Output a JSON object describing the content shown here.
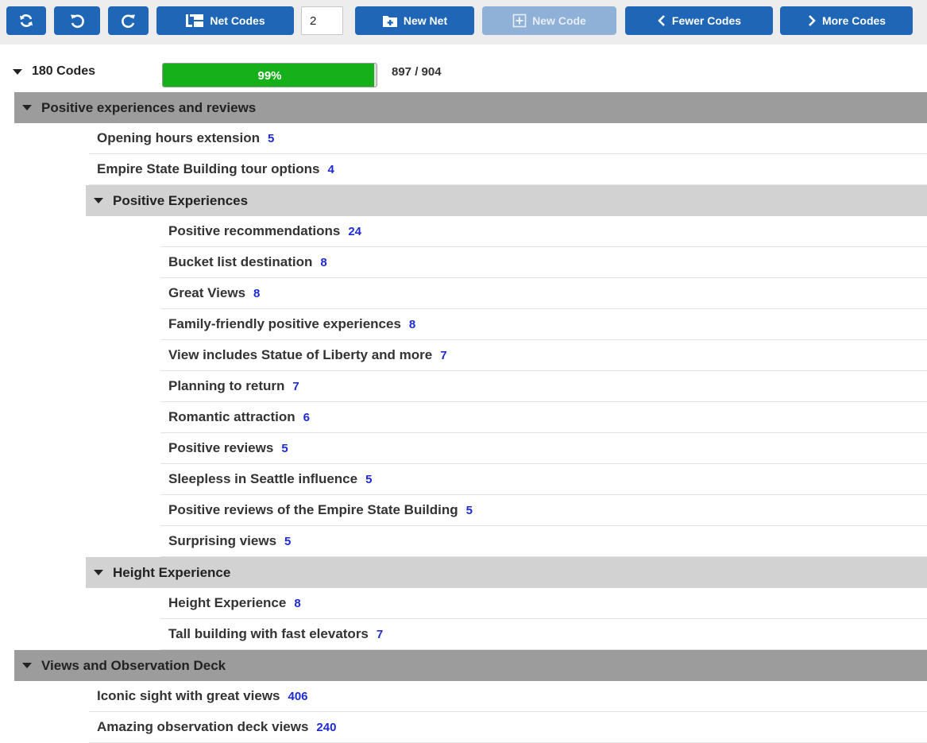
{
  "toolbar": {
    "net_codes_label": "Net Codes",
    "level_value": "2",
    "new_net_label": "New Net",
    "new_code_label": "New Code",
    "fewer_codes_label": "Fewer Codes",
    "more_codes_label": "More Codes"
  },
  "summary": {
    "codes_label": "180 Codes",
    "progress_text": "99%",
    "progress_value": 0.99,
    "count_text": "897 / 904"
  },
  "colors": {
    "button": "#1f67b6",
    "progress": "#16b11a",
    "count": "#1e2bd0"
  },
  "groups": [
    {
      "label": "Positive experiences and reviews",
      "codes": [
        {
          "label": "Opening hours extension",
          "count": "5"
        },
        {
          "label": "Empire State Building tour options",
          "count": "4"
        }
      ],
      "subnets": [
        {
          "label": "Positive Experiences",
          "codes": [
            {
              "label": "Positive recommendations",
              "count": "24"
            },
            {
              "label": "Bucket list destination",
              "count": "8"
            },
            {
              "label": "Great Views",
              "count": "8"
            },
            {
              "label": "Family-friendly positive experiences",
              "count": "8"
            },
            {
              "label": "View includes Statue of Liberty and more",
              "count": "7"
            },
            {
              "label": "Planning to return",
              "count": "7"
            },
            {
              "label": "Romantic attraction",
              "count": "6"
            },
            {
              "label": "Positive reviews",
              "count": "5"
            },
            {
              "label": "Sleepless in Seattle influence",
              "count": "5"
            },
            {
              "label": "Positive reviews of the Empire State Building",
              "count": "5"
            },
            {
              "label": "Surprising views",
              "count": "5"
            }
          ]
        },
        {
          "label": "Height Experience",
          "codes": [
            {
              "label": "Height Experience",
              "count": "8"
            },
            {
              "label": "Tall building with fast elevators",
              "count": "7"
            }
          ]
        }
      ]
    },
    {
      "label": "Views and Observation Deck",
      "codes": [
        {
          "label": "Iconic sight with great views",
          "count": "406"
        },
        {
          "label": "Amazing observation deck views",
          "count": "240"
        }
      ],
      "subnets": []
    }
  ]
}
